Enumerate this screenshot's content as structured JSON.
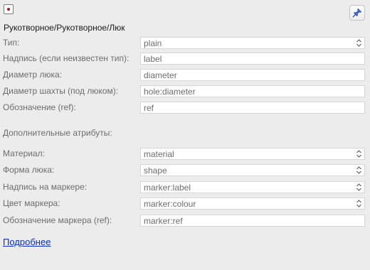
{
  "preset": {
    "title": "Рукотворное/Рукотворное/Люк",
    "icon": "manhole-preset-icon",
    "pin_icon": "pushpin-icon"
  },
  "fields": {
    "type": {
      "label": "Тип:",
      "value": "plain",
      "control": "combo"
    },
    "inscription": {
      "label": "Надпись (если неизвестен тип):",
      "value": "label",
      "control": "text"
    },
    "diameter": {
      "label": "Диаметр люка:",
      "value": "diameter",
      "control": "text"
    },
    "hole_diameter": {
      "label": "Диаметр шахты (под люком):",
      "value": "hole:diameter",
      "control": "text"
    },
    "ref": {
      "label": "Обозначение (ref):",
      "value": "ref",
      "control": "text"
    }
  },
  "additional": {
    "heading": "Дополнительные атрибуты:",
    "material": {
      "label": "Материал:",
      "value": "material",
      "control": "combo"
    },
    "shape": {
      "label": "Форма люка:",
      "value": "shape",
      "control": "combo"
    },
    "marker_label": {
      "label": "Надпись на маркере:",
      "value": "marker:label",
      "control": "combo"
    },
    "marker_colour": {
      "label": "Цвет маркера:",
      "value": "marker:colour",
      "control": "combo"
    },
    "marker_ref": {
      "label": "Обозначение маркера (ref):",
      "value": "marker:ref",
      "control": "text"
    }
  },
  "more_link": "Подробнее",
  "colors": {
    "link": "#0b2ccb",
    "icon_dot": "#b01515",
    "pin": "#3d6bd8"
  }
}
